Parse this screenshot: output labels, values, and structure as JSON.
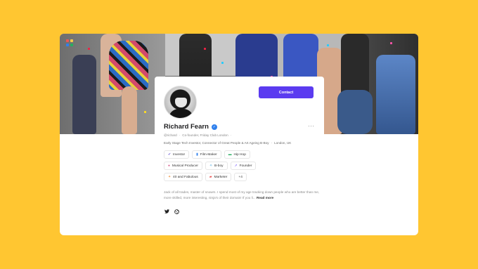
{
  "profile": {
    "contact_label": "Contact",
    "name": "Richard Fearn",
    "handle": "@richard",
    "role": "Co-founder, Friday Club London",
    "headline": "Early Stage Tech Investor, Connector of Great People & Art Ageing B-Boy",
    "location": "London, UK",
    "more_label": "···",
    "verified_glyph": "✓"
  },
  "tags": [
    [
      {
        "label": "Investor",
        "icon": "✔",
        "color": "#6b5bd6",
        "icon_name": "check-icon"
      },
      {
        "label": "Film-Maker",
        "icon": "▮",
        "color": "#2f80ed",
        "icon_name": "camera-icon"
      },
      {
        "label": "Hip Hop",
        "icon": "▬",
        "color": "#27ae60",
        "icon_name": "boombox-icon"
      }
    ],
    [
      {
        "label": "Musical Producer",
        "icon": "●",
        "color": "#d6578a",
        "icon_name": "music-icon"
      },
      {
        "label": "B-boy",
        "icon": "✧",
        "color": "#2d9cdb",
        "icon_name": "dancer-icon"
      },
      {
        "label": "Founder",
        "icon": "➚",
        "color": "#7b61ff",
        "icon_name": "rocket-icon"
      }
    ],
    [
      {
        "label": "40 and Fabulous",
        "icon": "✦",
        "color": "#f2994a",
        "icon_name": "sparkle-icon"
      },
      {
        "label": "Marketer",
        "icon": "▰",
        "color": "#eb5757",
        "icon_name": "megaphone-icon"
      },
      {
        "label": "+4",
        "icon": "",
        "color": "#333333",
        "icon_name": ""
      }
    ]
  ],
  "about": {
    "text": "Jack of all trades, master of snowm. I spend most of my age tracking down people who are better than me, more skilled, more interesting, ninja's of their domain! If you li...",
    "read_more": "Read more"
  },
  "socials": [
    {
      "name": "twitter-icon",
      "glyph": "🐦"
    },
    {
      "name": "globe-icon",
      "glyph": "◍"
    }
  ],
  "colors": {
    "background": "#FFC631",
    "accent": "#5B3BF0",
    "verified": "#2F80ED"
  }
}
